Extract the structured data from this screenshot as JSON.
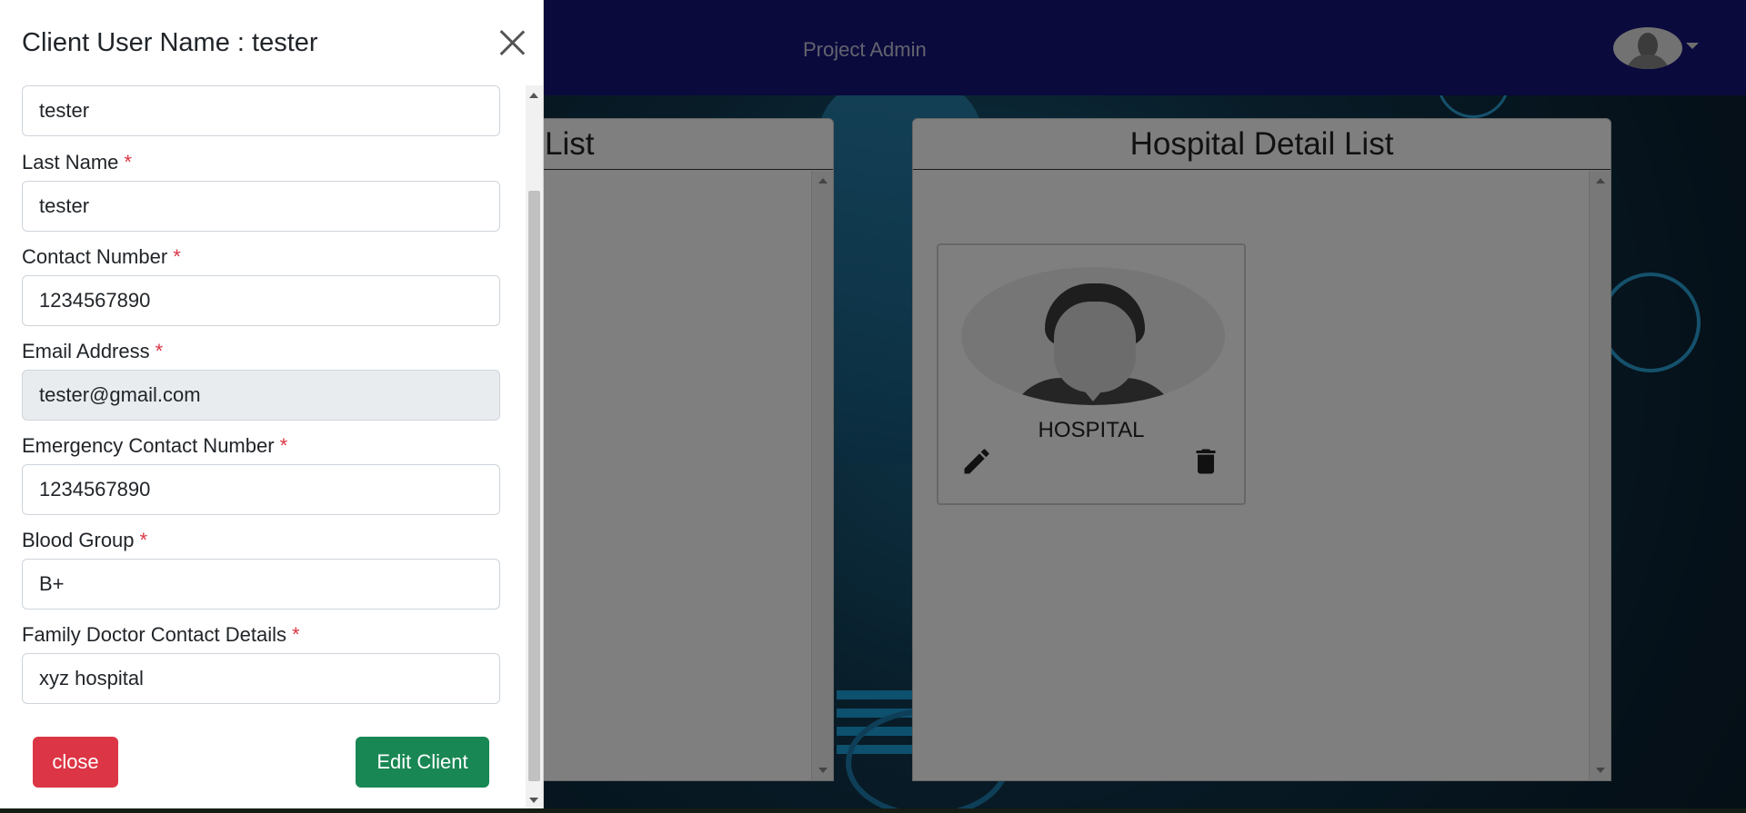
{
  "navbar": {
    "title": "Project Admin",
    "avatar_icon": "user-avatar-icon"
  },
  "panels": {
    "left": {
      "title": "List"
    },
    "right": {
      "title": "Hospital Detail List",
      "card": {
        "label": "HOSPITAL",
        "edit_icon": "pencil-icon",
        "delete_icon": "trash-icon"
      }
    }
  },
  "offcanvas": {
    "title": "Client User Name : tester",
    "fields": [
      {
        "label": "",
        "value": "tester",
        "required": false,
        "readonly": false
      },
      {
        "label": "Last Name",
        "value": "tester",
        "required": true,
        "readonly": false
      },
      {
        "label": "Contact Number",
        "value": "1234567890",
        "required": true,
        "readonly": false
      },
      {
        "label": "Email Address",
        "value": "tester@gmail.com",
        "required": true,
        "readonly": true
      },
      {
        "label": "Emergency Contact Number",
        "value": "1234567890",
        "required": true,
        "readonly": false
      },
      {
        "label": "Blood Group",
        "value": "B+",
        "required": true,
        "readonly": false
      },
      {
        "label": "Family Doctor Contact Details",
        "value": "xyz hospital",
        "required": true,
        "readonly": false
      }
    ],
    "required_marker": "*",
    "buttons": {
      "close_label": "close",
      "edit_label": "Edit Client"
    }
  },
  "colors": {
    "navbar": "#14147a",
    "danger": "#dc3545",
    "success": "#198754",
    "readonly_field": "#e9ecef"
  }
}
